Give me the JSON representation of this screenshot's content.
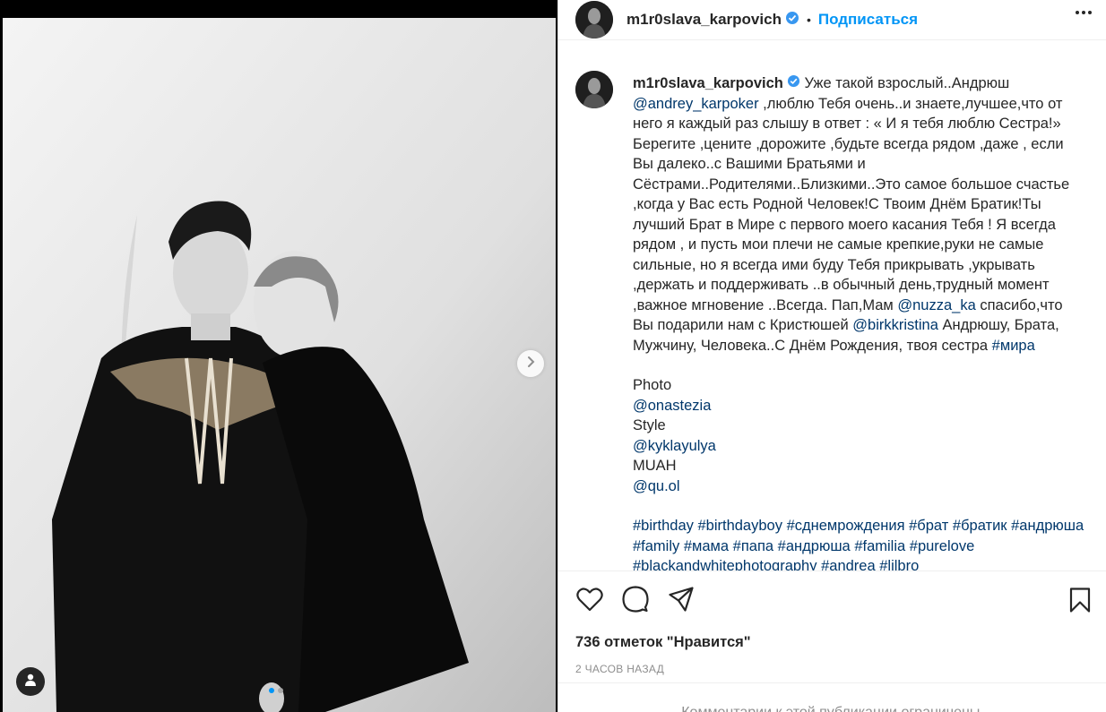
{
  "post": {
    "username": "m1r0slava_karpovich",
    "follow_label": "Подписаться",
    "separator": "•",
    "caption": {
      "username": "m1r0slava_karpovich",
      "p1_a": "Уже такой взрослый..Андрюш",
      "mention1": "@andrey_karpoker",
      "p1_b": ",люблю Тебя очень..и знаете,лучшее,что от него я каждый раз слышу в ответ : « И я тебя люблю Сестра!» Берегите ,цените ,дорожите ,будьте всегда рядом ,даже , если Вы далеко..с Вашими Братьями и Сёстрами..Родителями..Близкими..Это самое большое счастье ,когда у Вас есть Родной Человек!С Твоим Днём Братик!Ты лучший Брат в Мире с первого моего касания Тебя ! Я всегда рядом , и пусть мои плечи не самые крепкие,руки не самые сильные, но я всегда ими буду Тебя прикрывать ,укрывать ,держать и поддерживать ..в обычный день,трудный момент ,важное мгновение ..Всегда. Пап,Мам",
      "mention2": "@nuzza_ka",
      "p1_c": "спасибо,что Вы подарили нам с Кристюшей",
      "mention3": "@birkkristina",
      "p1_d": "Андрюшу, Брата, Мужчину, Человека..С Днём Рождения, твоя сестра",
      "hashtag_mira": "#мира",
      "photo_label": "Photo",
      "photo_mention": "@onastezia",
      "style_label": "Style",
      "style_mention": "@kyklayulya",
      "muah_label": "MUAH",
      "muah_mention": "@qu.ol",
      "hashtags": [
        "#birthday",
        "#birthdayboy",
        "#сднемрождения",
        "#брат",
        "#братик",
        "#андрюша",
        "#family",
        "#мама",
        "#папа",
        "#андрюша",
        "#familia",
        "#purelove",
        "#blackandwhitephotography",
        "#andrea",
        "#lilbro"
      ]
    },
    "likes_text": "736 отметок \"Нравится\"",
    "time_text": "2 ЧАСОВ НАЗАД",
    "comments_disabled": "Комментарии к этой публикации ограничены."
  },
  "icons": {
    "like": "heart-icon",
    "comment": "comment-icon",
    "share": "paper-plane-icon",
    "save": "bookmark-icon",
    "more": "more-dots-icon",
    "next": "chevron-right-icon",
    "tags": "user-tag-icon",
    "verified": "verified-badge-icon"
  },
  "colors": {
    "accent": "#0095f6",
    "link": "#00376b",
    "text": "#262626",
    "muted": "#8e8e8e",
    "verified": "#3897f0"
  },
  "carousel": {
    "current": 1,
    "total": 2
  }
}
